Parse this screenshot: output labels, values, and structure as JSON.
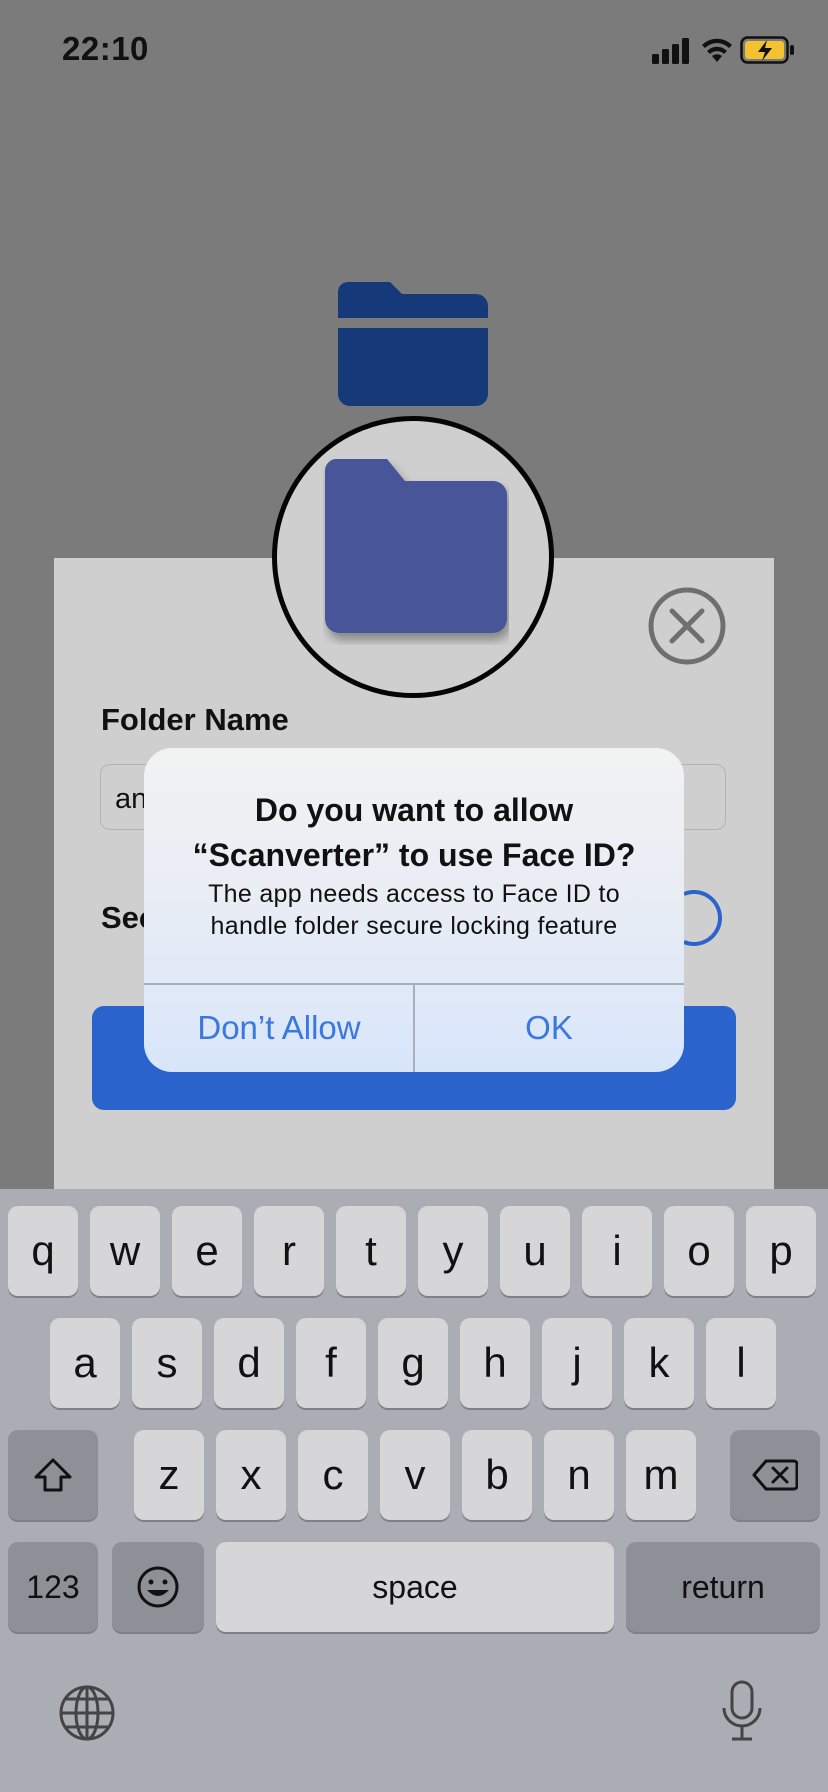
{
  "status": {
    "time": "22:10"
  },
  "form": {
    "folder_name_label": "Folder Name",
    "folder_name_value": "an",
    "secure_label": "Sec"
  },
  "alert": {
    "title": "Do you want to allow\n“Scanverter” to use Face ID?",
    "message": "The app needs access to Face ID to\nhandle folder secure locking feature",
    "deny_label": "Don’t Allow",
    "ok_label": "OK"
  },
  "keyboard": {
    "row1": [
      "q",
      "w",
      "e",
      "r",
      "t",
      "y",
      "u",
      "i",
      "o",
      "p"
    ],
    "row2": [
      "a",
      "s",
      "d",
      "f",
      "g",
      "h",
      "j",
      "k",
      "l"
    ],
    "row3": [
      "z",
      "x",
      "c",
      "v",
      "b",
      "n",
      "m"
    ],
    "numbers_label": "123",
    "space_label": "space",
    "return_label": "return"
  },
  "icons": [
    "signal-icon",
    "wifi-icon",
    "battery-charging-icon",
    "folder-icon",
    "close-icon",
    "shift-icon",
    "delete-icon",
    "emoji-icon",
    "globe-icon",
    "microphone-icon"
  ],
  "colors": {
    "primary_button": "#2b63cc",
    "alert_button_text": "#3a78e0",
    "folder_blue_top": "#16397a",
    "folder_circle": "#4a5599"
  }
}
